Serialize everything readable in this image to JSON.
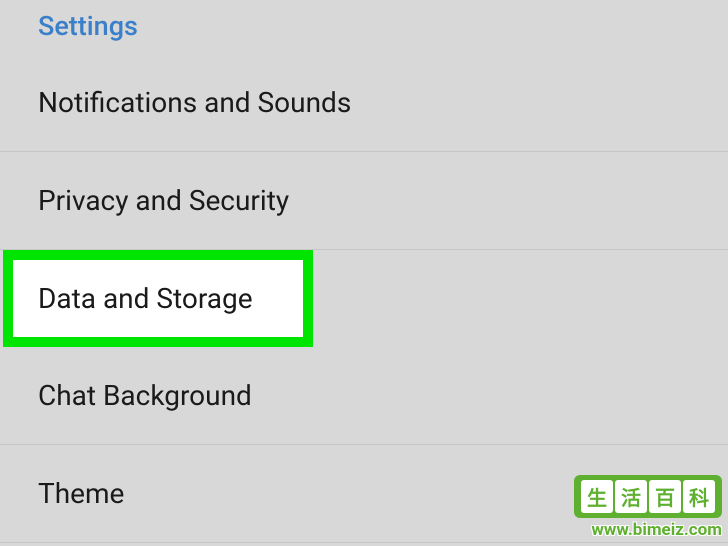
{
  "header": {
    "title": "Settings"
  },
  "settings": {
    "items": [
      {
        "label": "Notifications and Sounds",
        "value": ""
      },
      {
        "label": "Privacy and Security",
        "value": ""
      },
      {
        "label": "Data and Storage",
        "value": "",
        "highlighted": true
      },
      {
        "label": "Chat Background",
        "value": ""
      },
      {
        "label": "Theme",
        "value": ""
      }
    ]
  },
  "watermark": {
    "chars": [
      "生",
      "活",
      "百",
      "科"
    ],
    "url": "www.bimeiz.com"
  }
}
